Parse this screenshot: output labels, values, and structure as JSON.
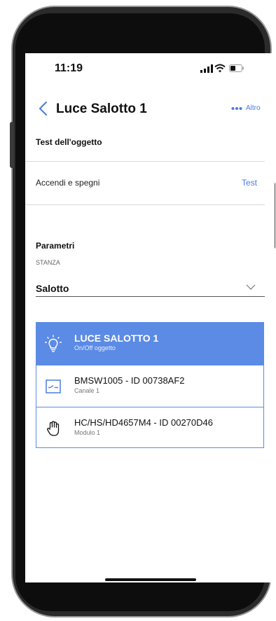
{
  "status_bar": {
    "time": "11:19"
  },
  "nav": {
    "title": "Luce Salotto 1",
    "more_label": "Altro"
  },
  "test_section": {
    "heading": "Test dell'oggetto",
    "row_label": "Accendi e spegni",
    "action_label": "Test"
  },
  "params": {
    "heading": "Parametri",
    "room_label": "STANZA",
    "room_value": "Salotto"
  },
  "list": {
    "items": [
      {
        "title": "LUCE SALOTTO 1",
        "subtitle": "On/Off oggetto",
        "icon": "lightbulb-icon",
        "selected": true
      },
      {
        "title": "BMSW1005 - ID 00738AF2",
        "subtitle": "Canale 1",
        "icon": "switch-icon",
        "selected": false
      },
      {
        "title": "HC/HS/HD4657M4 - ID 00270D46",
        "subtitle": "Modulo 1",
        "icon": "hand-icon",
        "selected": false
      }
    ]
  },
  "colors": {
    "accent": "#5b8be5",
    "link": "#4a7be0"
  }
}
